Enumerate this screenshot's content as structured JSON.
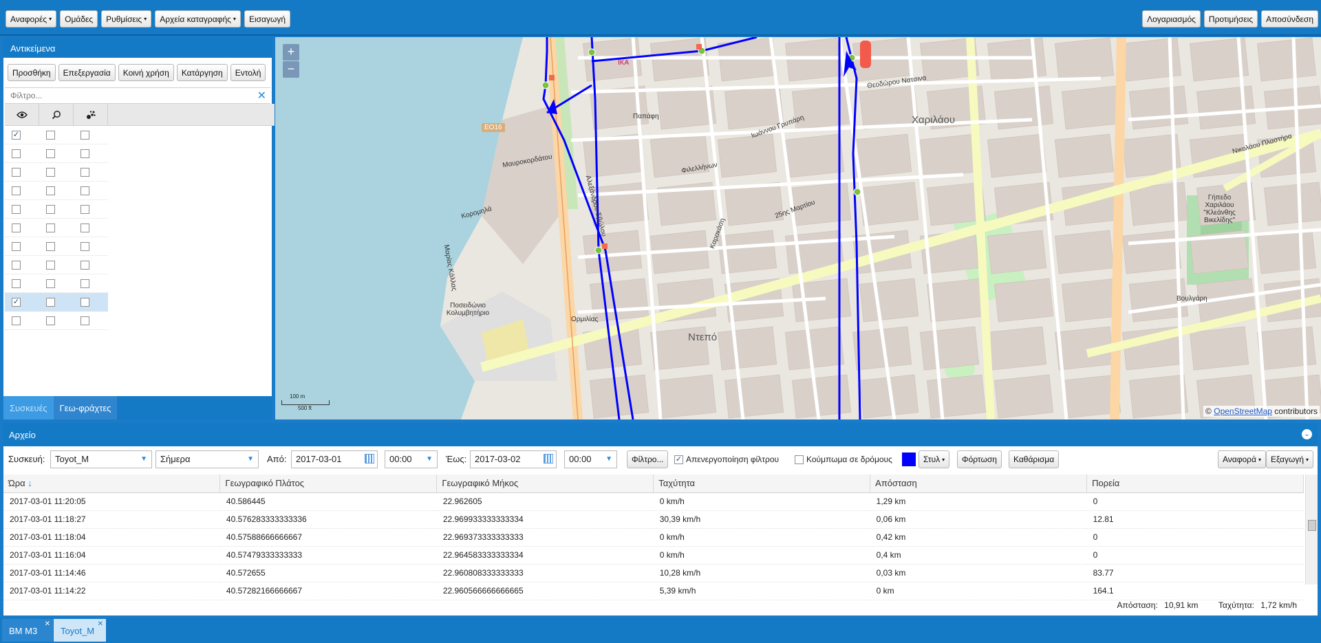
{
  "topbar": {
    "left_menus": [
      {
        "label": "Αναφορές",
        "caret": true
      },
      {
        "label": "Ομάδες",
        "caret": false
      },
      {
        "label": "Ρυθμίσεις",
        "caret": true
      },
      {
        "label": "Αρχεία καταγραφής",
        "caret": true
      },
      {
        "label": "Εισαγωγή",
        "caret": false
      }
    ],
    "right_menus": [
      "Λογαριασμός",
      "Προτιμήσεις",
      "Αποσύνδεση"
    ]
  },
  "objects": {
    "title": "Αντικείμενα",
    "buttons": [
      "Προσθήκη",
      "Επεξεργασία",
      "Κοινή χρήση",
      "Κατάργηση",
      "Εντολή"
    ],
    "filter_placeholder": "Φίλτρο...",
    "columns": [
      "eye-icon",
      "search-icon",
      "paw-icon"
    ],
    "rows": [
      {
        "visible": true,
        "selected": false
      },
      {
        "visible": false,
        "selected": false
      },
      {
        "visible": false,
        "selected": false
      },
      {
        "visible": false,
        "selected": false
      },
      {
        "visible": false,
        "selected": false
      },
      {
        "visible": false,
        "selected": false
      },
      {
        "visible": false,
        "selected": false
      },
      {
        "visible": false,
        "selected": false
      },
      {
        "visible": false,
        "selected": false
      },
      {
        "visible": true,
        "selected": true
      },
      {
        "visible": false,
        "selected": false
      }
    ],
    "tabs": [
      "Συσκευές",
      "Γεω-φράχτες"
    ]
  },
  "map": {
    "zoom_in": "+",
    "zoom_out": "−",
    "scale_top": "100 m",
    "scale_bottom": "500 ft",
    "attribution_prefix": "©",
    "attribution_link": "OpenStreetMap",
    "attribution_suffix": "contributors",
    "labels": [
      "Χαριλάου",
      "Ντεπό",
      "25ης Μαρτίου",
      "Ποσειδώνιο Κολυμβητήριο",
      "Γήπεδο Χαριλάου \"Κλεάνθης Βικελίδης\"",
      "Μαυροκορδάτου",
      "Κορομηλά",
      "Φιλελλήνων",
      "Βουλγάρη",
      "Νικολάου Πλαστήρα",
      "Θεοδώρου Νατσινα",
      "Ιωάννου Γρυπάρη",
      "Καρακάση",
      "Παπάφη",
      "ΕΟ16",
      "Μαρίας Κάλλας",
      "Αλεξάνδρου Σβώλου",
      "Ορμιλίας",
      "IKA"
    ],
    "route_color": "#0000ff"
  },
  "archive": {
    "title": "Αρχείο",
    "device_label": "Συσκευή:",
    "device_value": "Toyot_M",
    "period_value": "Σήμερα",
    "from_label": "Από:",
    "from_date": "2017-03-01",
    "from_time": "00:00",
    "to_label": "Έως:",
    "to_date": "2017-03-02",
    "to_time": "00:00",
    "filter_button": "Φίλτρο...",
    "disable_filter_label": "Απενεργοποίηση φίλτρου",
    "disable_filter_checked": true,
    "snap_label": "Κούμπωμα σε δρόμους",
    "snap_checked": false,
    "style_color": "#0000ff",
    "style_button": "Στυλ",
    "load_button": "Φόρτωση",
    "clear_button": "Καθάρισμα",
    "report_button": "Αναφορά",
    "export_button": "Εξαγωγή",
    "columns": [
      "Ώρα",
      "Γεωγραφικό Πλάτος",
      "Γεωγραφικό Μήκος",
      "Ταχύτητα",
      "Απόσταση",
      "Πορεία"
    ],
    "rows": [
      [
        "2017-03-01 11:20:05",
        "40.586445",
        "22.962605",
        "0 km/h",
        "1,29 km",
        "0"
      ],
      [
        "2017-03-01 11:18:27",
        "40.576283333333336",
        "22.969933333333334",
        "30,39 km/h",
        "0,06 km",
        "12.81"
      ],
      [
        "2017-03-01 11:18:04",
        "40.57588666666667",
        "22.969373333333333",
        "0 km/h",
        "0,42 km",
        "0"
      ],
      [
        "2017-03-01 11:16:04",
        "40.57479333333333",
        "22.964583333333334",
        "0 km/h",
        "0,4 km",
        "0"
      ],
      [
        "2017-03-01 11:14:46",
        "40.572655",
        "22.960808333333333",
        "10,28 km/h",
        "0,03 km",
        "83.77"
      ],
      [
        "2017-03-01 11:14:22",
        "40.57282166666667",
        "22.960566666666665",
        "5,39 km/h",
        "0 km",
        "164.1"
      ]
    ],
    "summary": {
      "distance_label": "Απόσταση:",
      "distance_value": "10,91 km",
      "speed_label": "Ταχύτητα:",
      "speed_value": "1,72 km/h"
    }
  },
  "bottom_tabs": [
    {
      "label": "BM M3",
      "active": false
    },
    {
      "label": "Toyot_M",
      "active": true
    }
  ]
}
